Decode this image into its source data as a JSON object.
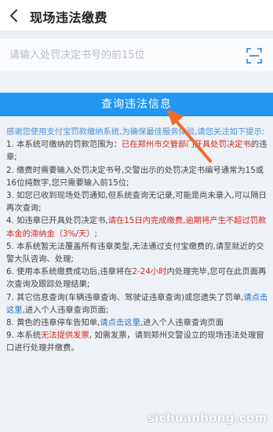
{
  "header": {
    "title": "现场违法缴费"
  },
  "search": {
    "placeholder": "请输入处罚决定书号的前15位",
    "value": ""
  },
  "actions": {
    "query_label": "查询违法信息"
  },
  "notes": {
    "intro": "感谢您使用支付宝罚款缴纳系统,为确保最佳服务体验,请您关注如下提示:",
    "item1_a": "1. 本系统可缴纳的罚款范围为：",
    "item1_red": "已在郑州市交管部门开具处罚决定书",
    "item1_b": "的违章;",
    "item2": "2. 缴费时需要输入处罚决定书号,交警出示的处罚决定书编号通常为15或16位纯数字,您只需要输入前15位;",
    "item3": "3. 如您已收到现场处罚通知,但系统查询无记录,可能是尚未录入,可以隔日再次查询;",
    "item4_a": "4. 如违章已开具处罚决定书,",
    "item4_red": "请在15日内完成缴费,逾期将产生不超过罚款本金的滞纳金（3%/天）",
    "item4_b": ";",
    "item5": "5. 本系统暂无法覆盖所有违章类型,无法通过支付宝缴费的,请至就近的交警大队咨询、处理;",
    "item6_a": "6. 使用本系统缴费成功后,违章将在",
    "item6_red": "2-24小时",
    "item6_b": "内处理完毕,您可在此页面再次查询及跟踪处理结果;",
    "item7_a": "7. 其它信息查询(车辆违章查询、驾驶证违章查询)或您遗失了罚单,",
    "item7_link": "请点击这里",
    "item7_b": ",进入个人违章查询页面;",
    "item8_a": "8. 黄色的违章停车告知单,",
    "item8_link": "请点击这里",
    "item8_b": ",进入个人违章查询页面",
    "item9_a": "9. 本系统",
    "item9_red": "无法提供发票",
    "item9_b": ", 如需发票，请到郑州交警设立的现场违法处理窗口进行处理并缴费。"
  },
  "watermark": "sichuanhong.com",
  "colors": {
    "primary": "#2196f3",
    "warning": "#d7261d",
    "link": "#1e6fd4",
    "arrow": "#f26a2e"
  },
  "icons": {
    "back": "chevron-left-icon",
    "scan": "scan-icon"
  }
}
